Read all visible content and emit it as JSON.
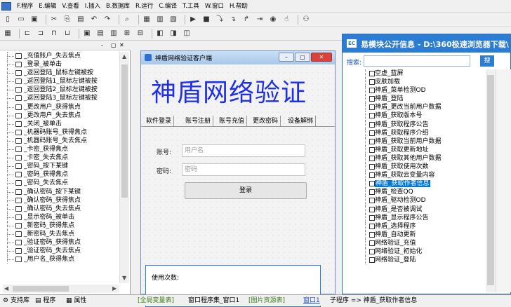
{
  "menu": [
    "F.程序",
    "E.编辑",
    "V.查看",
    "I.插入",
    "B.数据库",
    "R.运行",
    "C.编译",
    "T.工具",
    "W.窗口",
    "H.帮助"
  ],
  "left_tree": {
    "items": [
      "_充值账户_失去焦点",
      "_登录_被单击",
      "_返回登陆_鼠标左键被按",
      "_返回登陆1_鼠标左键被按",
      "_返回登陆2_鼠标左键被按",
      "_返回登陆3_鼠标左键被按",
      "_更改用户_获得焦点",
      "_更改用户_失去焦点",
      "_关闭_被单击",
      "_机器码账号_获得焦点",
      "_机器码账号_失去焦点",
      "_卡密_获得焦点",
      "_卡密_失去焦点",
      "_密码_按下某键",
      "_密码_获得焦点",
      "_密码_失去焦点",
      "_确认密码_按下某键",
      "_确认密码_获得焦点",
      "_确认密码_失去焦点",
      "_显示密码_被单击",
      "_新密码_获得焦点",
      "_新密码_失去焦点",
      "_验证密码_获得焦点",
      "_验证密码_失去焦点",
      "_用户名_获得焦点"
    ]
  },
  "bottom_tabs": [
    "支持库",
    "程序",
    "属性"
  ],
  "doc_tabs": [
    "[全局变量表]",
    "窗口程序集_窗口1",
    "[图片资源表]",
    "窗口1",
    "子程序 => 神盾_获取作者信息"
  ],
  "form": {
    "title": "神盾网络验证客户端",
    "big_title": "神盾网络验证",
    "tabs": [
      "软件登录",
      "账号注册",
      "账号充值",
      "更改密码",
      "设备解绑"
    ],
    "account_label": "账号:",
    "account_placeholder": "用户名",
    "password_label": "密码:",
    "password_placeholder": "密码",
    "login_button": "登录",
    "count_label": "使用次数:"
  },
  "right_window": {
    "title": "易模块公开信息 - D:\\360极速浏览器下载\\",
    "search_label": "搜索:",
    "search_button": "搜",
    "items": [
      "空虚_蓝屏",
      "皮肤加载",
      "神盾_菜单检测OD",
      "神盾_登陆",
      "神盾_更改当前用户数据",
      "神盾_获取版本号",
      "神盾_获取程序公告",
      "神盾_获取程序介绍",
      "神盾_获取当前用户数据",
      "神盾_获取更新地址",
      "神盾_获取其他用户数据",
      "神盾_获取使用次数",
      "神盾_获取云变量内容",
      "神盾_获取作者信息",
      "神盾_检查QQ",
      "神盾_驱动检测OD",
      "神盾_是否被调试",
      "神盾_显示程序公告",
      "神盾_选择程序",
      "神盾_自动更新",
      "网络验证_充值",
      "网络验证_初始化",
      "网络验证_登陆"
    ],
    "selected_index": 13
  },
  "colors": {
    "accent": "#2b7cd3",
    "title_text": "#2030e8",
    "selection": "#0078d7"
  }
}
